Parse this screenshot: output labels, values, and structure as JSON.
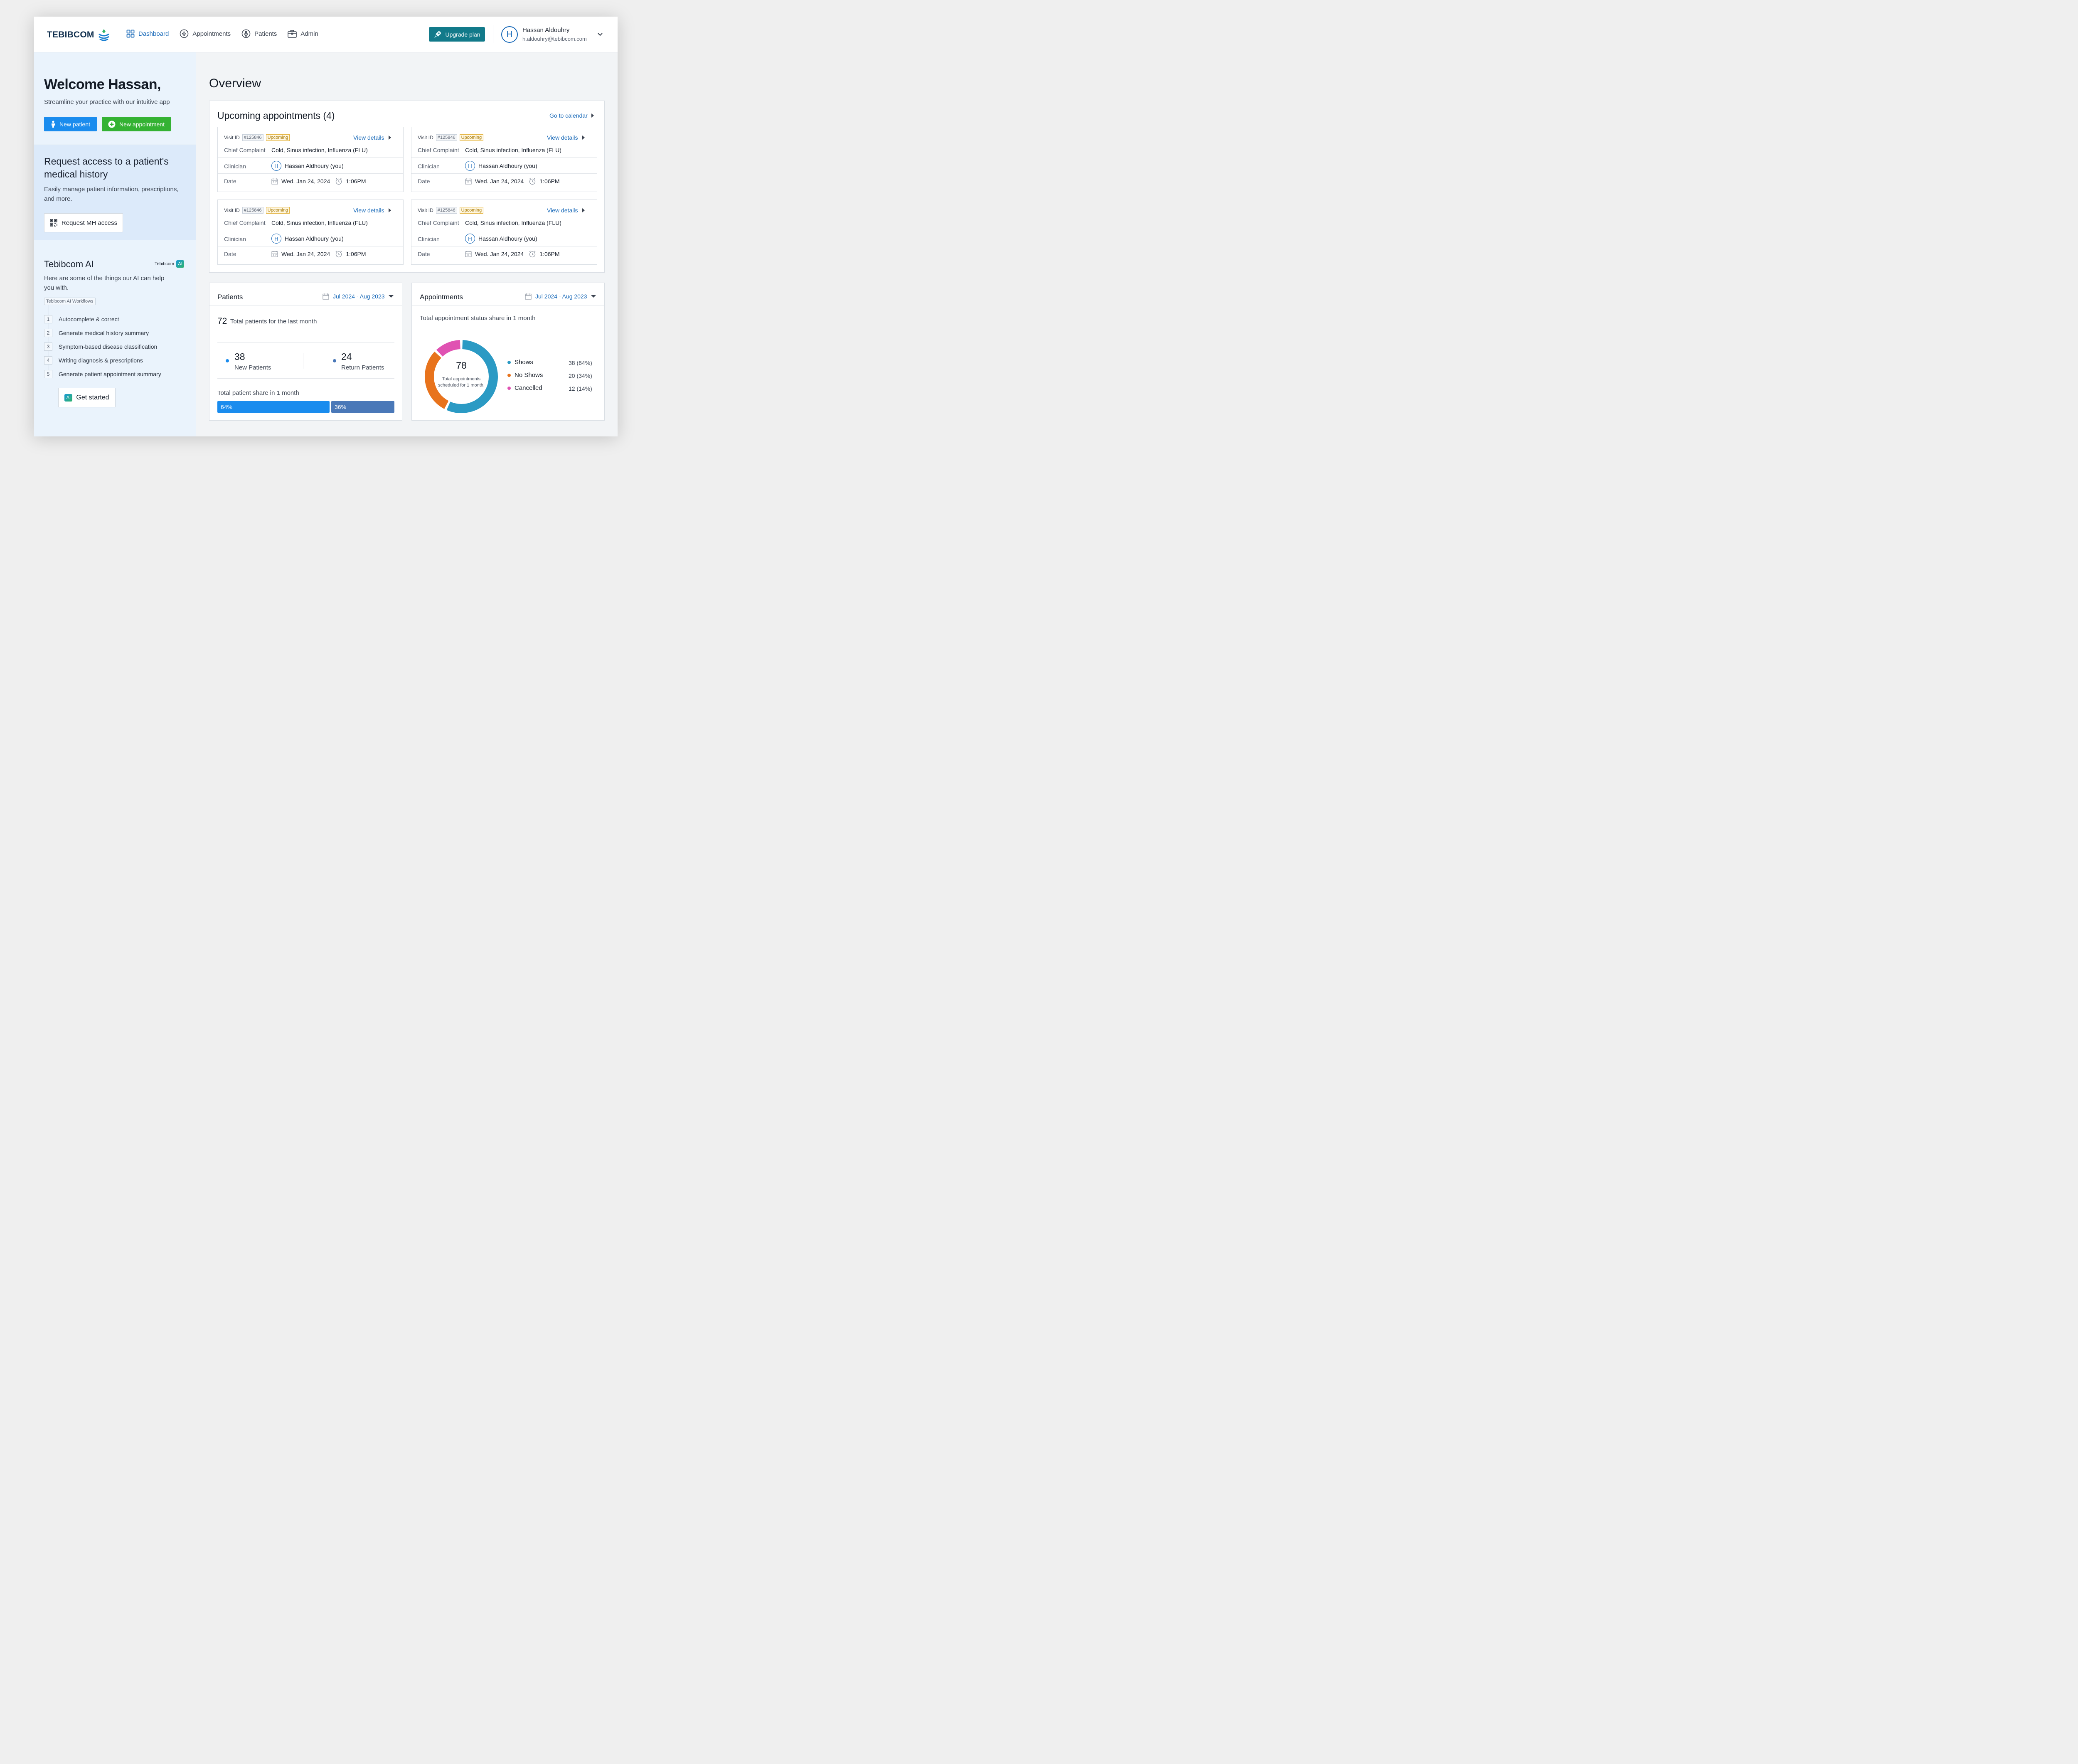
{
  "brand": {
    "name": "TEBIBCOM"
  },
  "nav": [
    {
      "label": "Dashboard",
      "icon": "grid-icon",
      "active": true
    },
    {
      "label": "Appointments",
      "icon": "plus-circle-icon",
      "active": false
    },
    {
      "label": "Patients",
      "icon": "person-circle-icon",
      "active": false
    },
    {
      "label": "Admin",
      "icon": "briefcase-icon",
      "active": false
    }
  ],
  "upgrade_label": "Upgrade plan",
  "user": {
    "initial": "H",
    "name": "Hassan Aldouhry",
    "email": "h.aldouhry@tebibcom.com"
  },
  "welcome": {
    "title": "Welcome Hassan,",
    "subtitle": "Streamline your practice with our intuitive app",
    "new_patient": "New patient",
    "new_appointment": "New appointment"
  },
  "mh": {
    "title": "Request access to a patient's medical history",
    "desc": "Easily manage patient information, prescriptions, and more.",
    "button": "Request MH access"
  },
  "ai": {
    "title": "Tebibcom AI",
    "brand": "Tebibcom",
    "badge": "AI",
    "desc": "Here are some of the things our AI can help you with.",
    "workflows_tag": "Tebibcom AI Workflows",
    "workflows": [
      {
        "num": "1",
        "label": "Autocomplete & correct"
      },
      {
        "num": "2",
        "label": "Generate medical history summary"
      },
      {
        "num": "3",
        "label": "Symptom-based disease classification"
      },
      {
        "num": "4",
        "label": "Writing diagnosis & prescriptions"
      },
      {
        "num": "5",
        "label": "Generate patient appointment summary"
      }
    ],
    "get_started": "Get started"
  },
  "overview_title": "Overview",
  "upcoming": {
    "title": "Upcoming appointments (4)",
    "go_to_calendar": "Go to calendar",
    "labels": {
      "visit_id": "Visit ID",
      "chief_complaint": "Chief Complaint",
      "clinician": "Clinician",
      "date": "Date",
      "view_details": "View details"
    },
    "items": [
      {
        "visit_id": "#125846",
        "status": "Upcoming",
        "complaint": "Cold, Sinus infection, Influenza (FLU)",
        "clinician_initial": "H",
        "clinician": "Hassan Aldhoury (you)",
        "date": "Wed. Jan 24, 2024",
        "time": "1:06PM"
      },
      {
        "visit_id": "#125846",
        "status": "Upcoming",
        "complaint": "Cold, Sinus infection, Influenza (FLU)",
        "clinician_initial": "H",
        "clinician": "Hassan Aldhoury (you)",
        "date": "Wed. Jan 24, 2024",
        "time": "1:06PM"
      },
      {
        "visit_id": "#125846",
        "status": "Upcoming",
        "complaint": "Cold, Sinus infection, Influenza (FLU)",
        "clinician_initial": "H",
        "clinician": "Hassan Aldhoury (you)",
        "date": "Wed. Jan 24, 2024",
        "time": "1:06PM"
      },
      {
        "visit_id": "#125846",
        "status": "Upcoming",
        "complaint": "Cold, Sinus infection, Influenza (FLU)",
        "clinician_initial": "H",
        "clinician": "Hassan Aldhoury (you)",
        "date": "Wed. Jan 24, 2024",
        "time": "1:06PM"
      }
    ]
  },
  "patients": {
    "title": "Patients",
    "date_range": "Jul 2024 - Aug 2023",
    "total": "72",
    "total_label": "Total patients for the last month",
    "new_count": "38",
    "new_label": "New Patients",
    "return_count": "24",
    "return_label": "Return Patients",
    "share_label": "Total patient share in 1 month",
    "new_share": "64%",
    "return_share": "36%",
    "new_share_value": 64,
    "return_share_value": 36,
    "colors": {
      "new": "#1a8cee",
      "return": "#4a78b8"
    }
  },
  "appointments": {
    "title": "Appointments",
    "date_range": "Jul 2024 - Aug 2023",
    "subtitle": "Total appointment status share in 1 month",
    "total": "78",
    "center_label": "Total appointments scheduled for 1 month.",
    "legend": [
      {
        "label": "Shows",
        "value": "38 (64%)",
        "color": "#2b9ac4"
      },
      {
        "label": "No Shows",
        "value": "20 (34%)",
        "color": "#e8731c"
      },
      {
        "label": "Cancelled",
        "value": "12 (14%)",
        "color": "#e052b2"
      }
    ]
  },
  "chart_data": {
    "type": "pie",
    "categories": [
      "Shows",
      "No Shows",
      "Cancelled"
    ],
    "values": [
      64,
      34,
      14
    ],
    "counts": [
      38,
      20,
      12
    ],
    "colors": [
      "#2b9ac4",
      "#e8731c",
      "#e052b2"
    ],
    "title": "Total appointment status share in 1 month"
  }
}
